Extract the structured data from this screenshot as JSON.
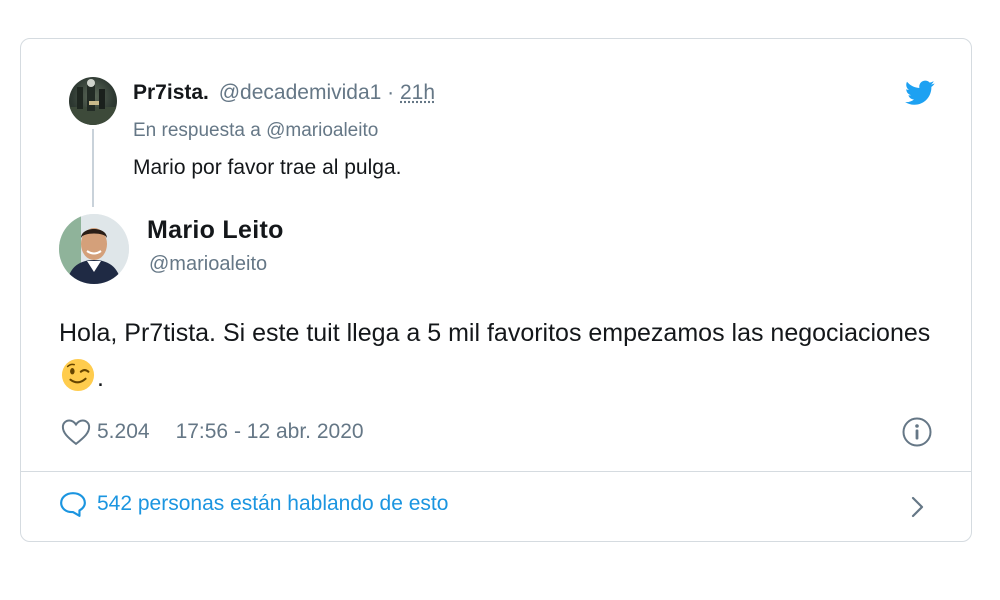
{
  "reply": {
    "name": "Pr7ista.",
    "handle": "@decademivida1",
    "separator": "·",
    "time": "21h",
    "in_reply_to_prefix": "En respuesta a",
    "in_reply_to_handle": "@marioaleito",
    "text": "Mario por favor trae al pulga."
  },
  "tweet": {
    "author_name": "Mario Leito",
    "author_handle": "@marioaleito",
    "text_before_emoji": "Hola, Pr7tista. Si este tuit llega a 5 mil favoritos empezamos las negociaciones ",
    "emoji": "winking-face-emoji",
    "text_after_emoji": ".",
    "likes": "5.204",
    "timestamp": "17:56 - 12 abr. 2020"
  },
  "footer": {
    "conversation_text": "542 personas están hablando de esto"
  },
  "colors": {
    "twitter_blue": "#1da1f2",
    "link_blue": "#1b95e0",
    "secondary_text": "#657786",
    "border": "#d5dbe0"
  },
  "icons": [
    "twitter-bird-icon",
    "heart-icon",
    "info-icon",
    "speech-bubble-icon",
    "chevron-right-icon"
  ]
}
